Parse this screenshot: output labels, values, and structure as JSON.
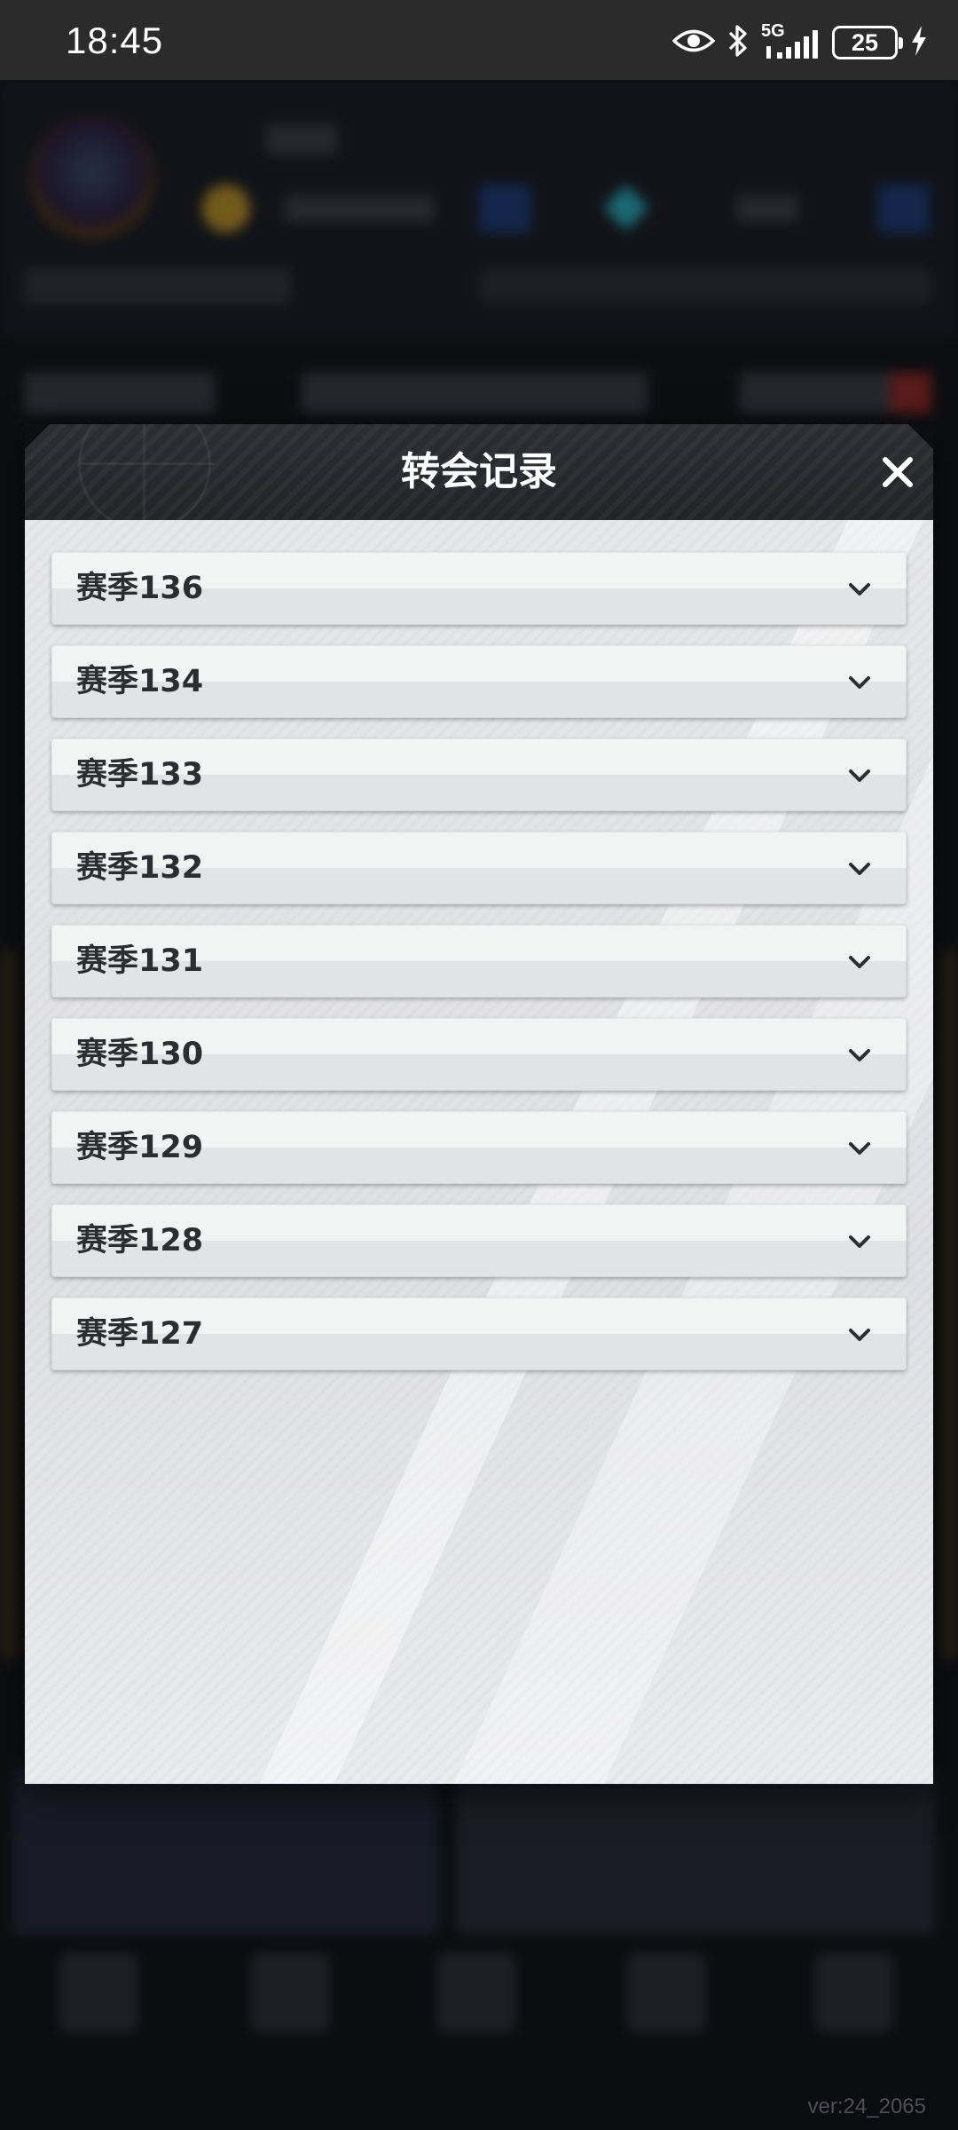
{
  "status_bar": {
    "time": "18:45",
    "network": "5G",
    "battery": "25"
  },
  "modal": {
    "title": "转会记录",
    "close_icon": "close-icon",
    "seasons": [
      {
        "label": "赛季136",
        "icon": "chevron-down-icon"
      },
      {
        "label": "赛季134",
        "icon": "chevron-down-icon"
      },
      {
        "label": "赛季133",
        "icon": "chevron-down-icon"
      },
      {
        "label": "赛季132",
        "icon": "chevron-down-icon"
      },
      {
        "label": "赛季131",
        "icon": "chevron-down-icon"
      },
      {
        "label": "赛季130",
        "icon": "chevron-down-icon"
      },
      {
        "label": "赛季129",
        "icon": "chevron-down-icon"
      },
      {
        "label": "赛季128",
        "icon": "chevron-down-icon"
      },
      {
        "label": "赛季127",
        "icon": "chevron-down-icon"
      }
    ]
  },
  "footer": {
    "version": "ver:24_2065"
  },
  "colors": {
    "header_bg": "#222428",
    "body_bg": "#e3e4e6",
    "item_text": "#2b2d31",
    "title_text": "#ffffff"
  }
}
